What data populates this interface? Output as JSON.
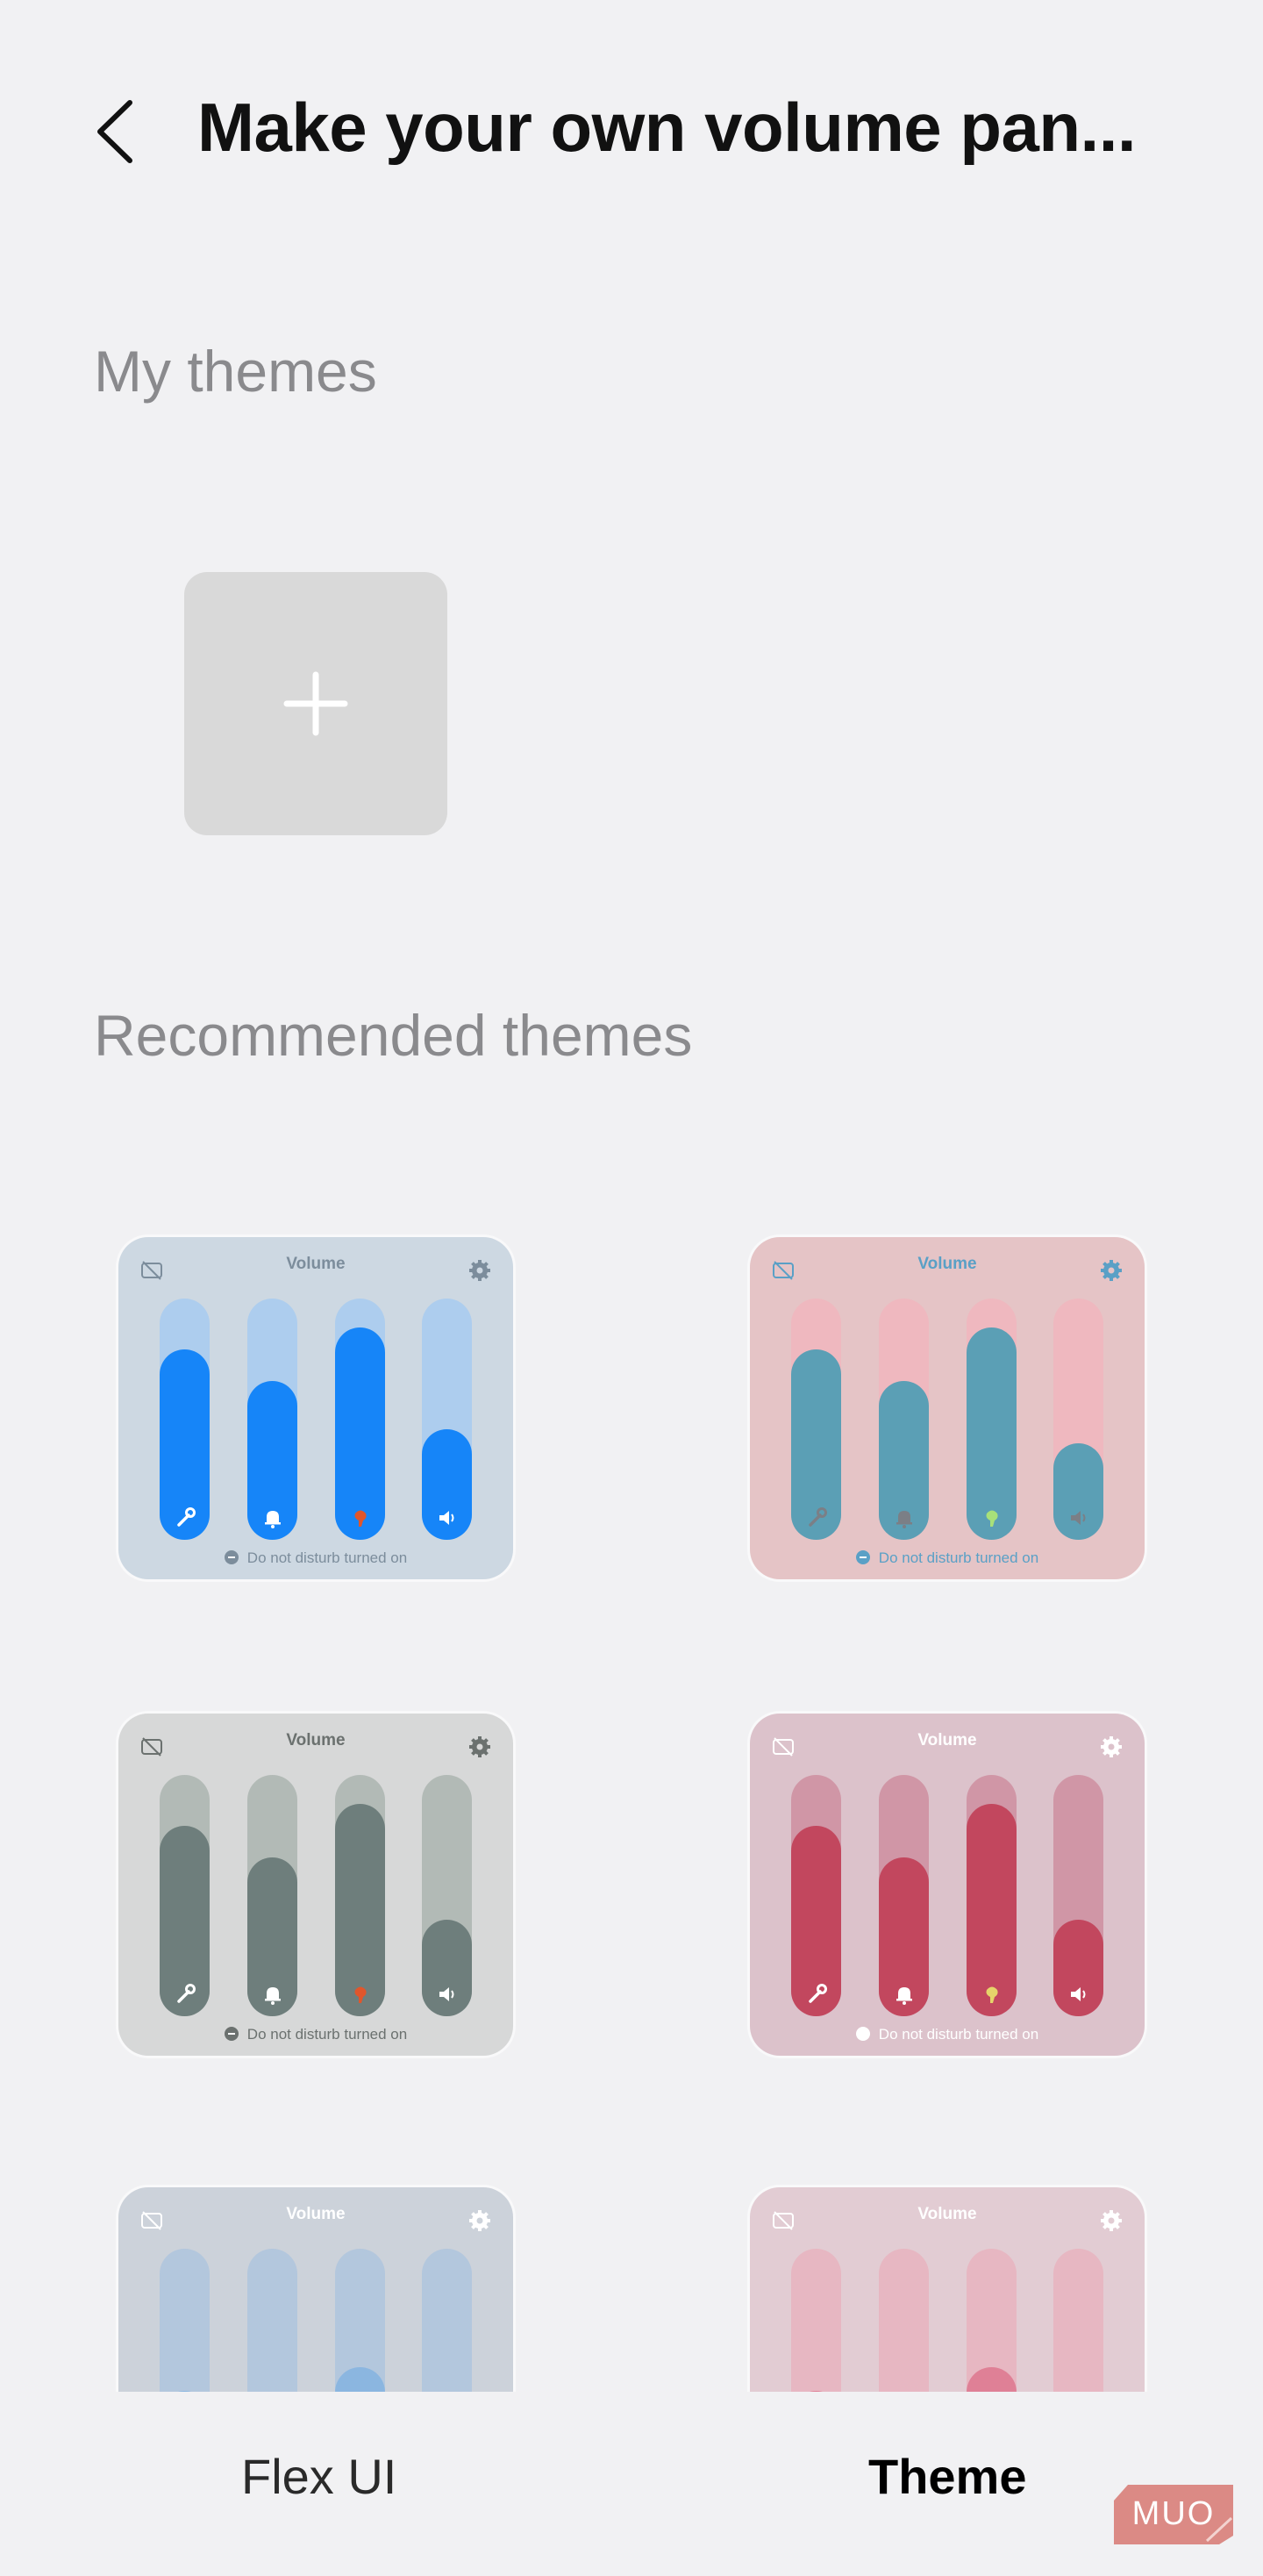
{
  "header": {
    "title": "Make your own volume pan...",
    "back_icon": "chevron-left-icon"
  },
  "my_themes": {
    "heading": "My themes",
    "add_icon": "plus-icon"
  },
  "recommended": {
    "heading": "Recommended themes",
    "themes": [
      {
        "label": "Volume",
        "dnd": "Do not disturb turned on",
        "bg": "#cdd8e2",
        "track": "#adcdee",
        "fill": "#1685f8",
        "text": "#7c8d9c",
        "icons": "#ffffff",
        "accent": "#e0562c",
        "levels": [
          0.79,
          0.66,
          0.88,
          0.46
        ]
      },
      {
        "label": "Volume",
        "dnd": "Do not disturb turned on",
        "bg": "#e5c4c6",
        "track": "#efb8bf",
        "fill": "#5b9fb5",
        "text": "#5aa0c6",
        "icons": "#7b7f86",
        "accent": "#a8e07a",
        "levels": [
          0.79,
          0.66,
          0.88,
          0.4
        ]
      },
      {
        "label": "Volume",
        "dnd": "Do not disturb turned on",
        "bg": "#d7d8d8",
        "track": "#b2bab6",
        "fill": "#6e7e7c",
        "text": "#6b716f",
        "icons": "#ffffff",
        "accent": "#e0562c",
        "levels": [
          0.79,
          0.66,
          0.88,
          0.4
        ]
      },
      {
        "label": "Volume",
        "dnd": "Do not disturb turned on",
        "bg": "#dcc2cb",
        "track": "#d096a6",
        "fill": "#c2475e",
        "text": "#ffffff",
        "icons": "#ffffff",
        "accent": "#e6d46a",
        "levels": [
          0.79,
          0.66,
          0.88,
          0.4
        ]
      },
      {
        "label": "Volume",
        "dnd": "",
        "bg": "#ccd2da",
        "track": "#b3c7dd",
        "fill": "#8bb6e0",
        "text": "#ffffff",
        "icons": "#ffffff",
        "accent": "#ffffff",
        "levels": [
          0.41,
          0.27,
          0.51,
          0.0
        ]
      },
      {
        "label": "Volume",
        "dnd": "",
        "bg": "#e2ccd3",
        "track": "#e7b7c2",
        "fill": "#df8096",
        "text": "#ffffff",
        "icons": "#ffffff",
        "accent": "#ffffff",
        "levels": [
          0.41,
          0.27,
          0.51,
          0.0
        ]
      }
    ]
  },
  "tabs": [
    {
      "label": "Flex UI",
      "selected": false
    },
    {
      "label": "Theme",
      "selected": true
    }
  ],
  "watermark": "MUO"
}
